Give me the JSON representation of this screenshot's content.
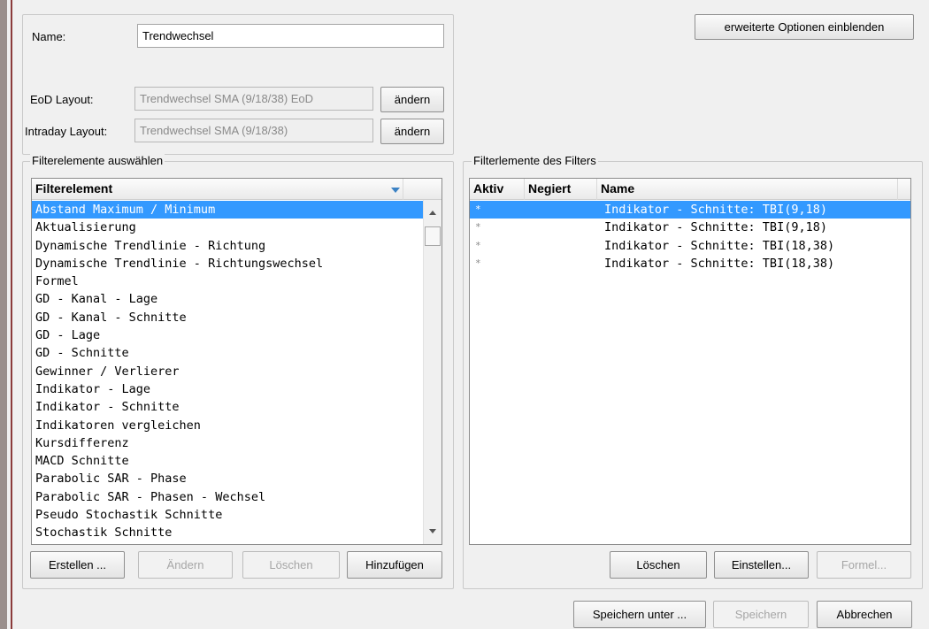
{
  "header": {
    "name_label": "Name:",
    "name_value": "Trendwechsel",
    "eod_label": "EoD Layout:",
    "eod_value": "Trendwechsel SMA (9/18/38) EoD",
    "intraday_label": "Intraday Layout:",
    "intraday_value": "Trendwechsel SMA (9/18/38)",
    "change_label": "ändern",
    "advanced_options_label": "erweiterte Optionen einblenden"
  },
  "left_panel": {
    "group_title": "Filterelemente auswählen",
    "column_header": "Filterelement",
    "items": [
      "Abstand  Maximum / Minimum",
      "Aktualisierung",
      "Dynamische Trendlinie - Richtung",
      "Dynamische Trendlinie - Richtungswechsel",
      "Formel",
      "GD - Kanal - Lage",
      "GD - Kanal - Schnitte",
      "GD - Lage",
      "GD - Schnitte",
      "Gewinner / Verlierer",
      "Indikator - Lage",
      "Indikator - Schnitte",
      "Indikatoren vergleichen",
      "Kursdifferenz",
      "MACD Schnitte",
      "Parabolic SAR - Phase",
      "Parabolic SAR - Phasen - Wechsel",
      "Pseudo Stochastik Schnitte",
      "Stochastik Schnitte"
    ],
    "selected_index": 0,
    "buttons": {
      "create": "Erstellen ...",
      "change": "Ändern",
      "delete": "Löschen",
      "add": "Hinzufügen"
    }
  },
  "right_panel": {
    "group_title": "Filterlemente des Filters",
    "columns": {
      "active": "Aktiv",
      "negated": "Negiert",
      "name": "Name"
    },
    "rows": [
      {
        "active": "*",
        "negated": "",
        "name": "Indikator - Schnitte: TBI(9,18)"
      },
      {
        "active": "*",
        "negated": "",
        "name": "Indikator - Schnitte: TBI(9,18)"
      },
      {
        "active": "*",
        "negated": "",
        "name": "Indikator - Schnitte: TBI(18,38)"
      },
      {
        "active": "*",
        "negated": "",
        "name": "Indikator - Schnitte: TBI(18,38)"
      }
    ],
    "selected_index": 0,
    "buttons": {
      "delete": "Löschen",
      "settings": "Einstellen...",
      "formula": "Formel..."
    }
  },
  "footer": {
    "save_as": "Speichern unter ...",
    "save": "Speichern",
    "cancel": "Abbrechen"
  }
}
